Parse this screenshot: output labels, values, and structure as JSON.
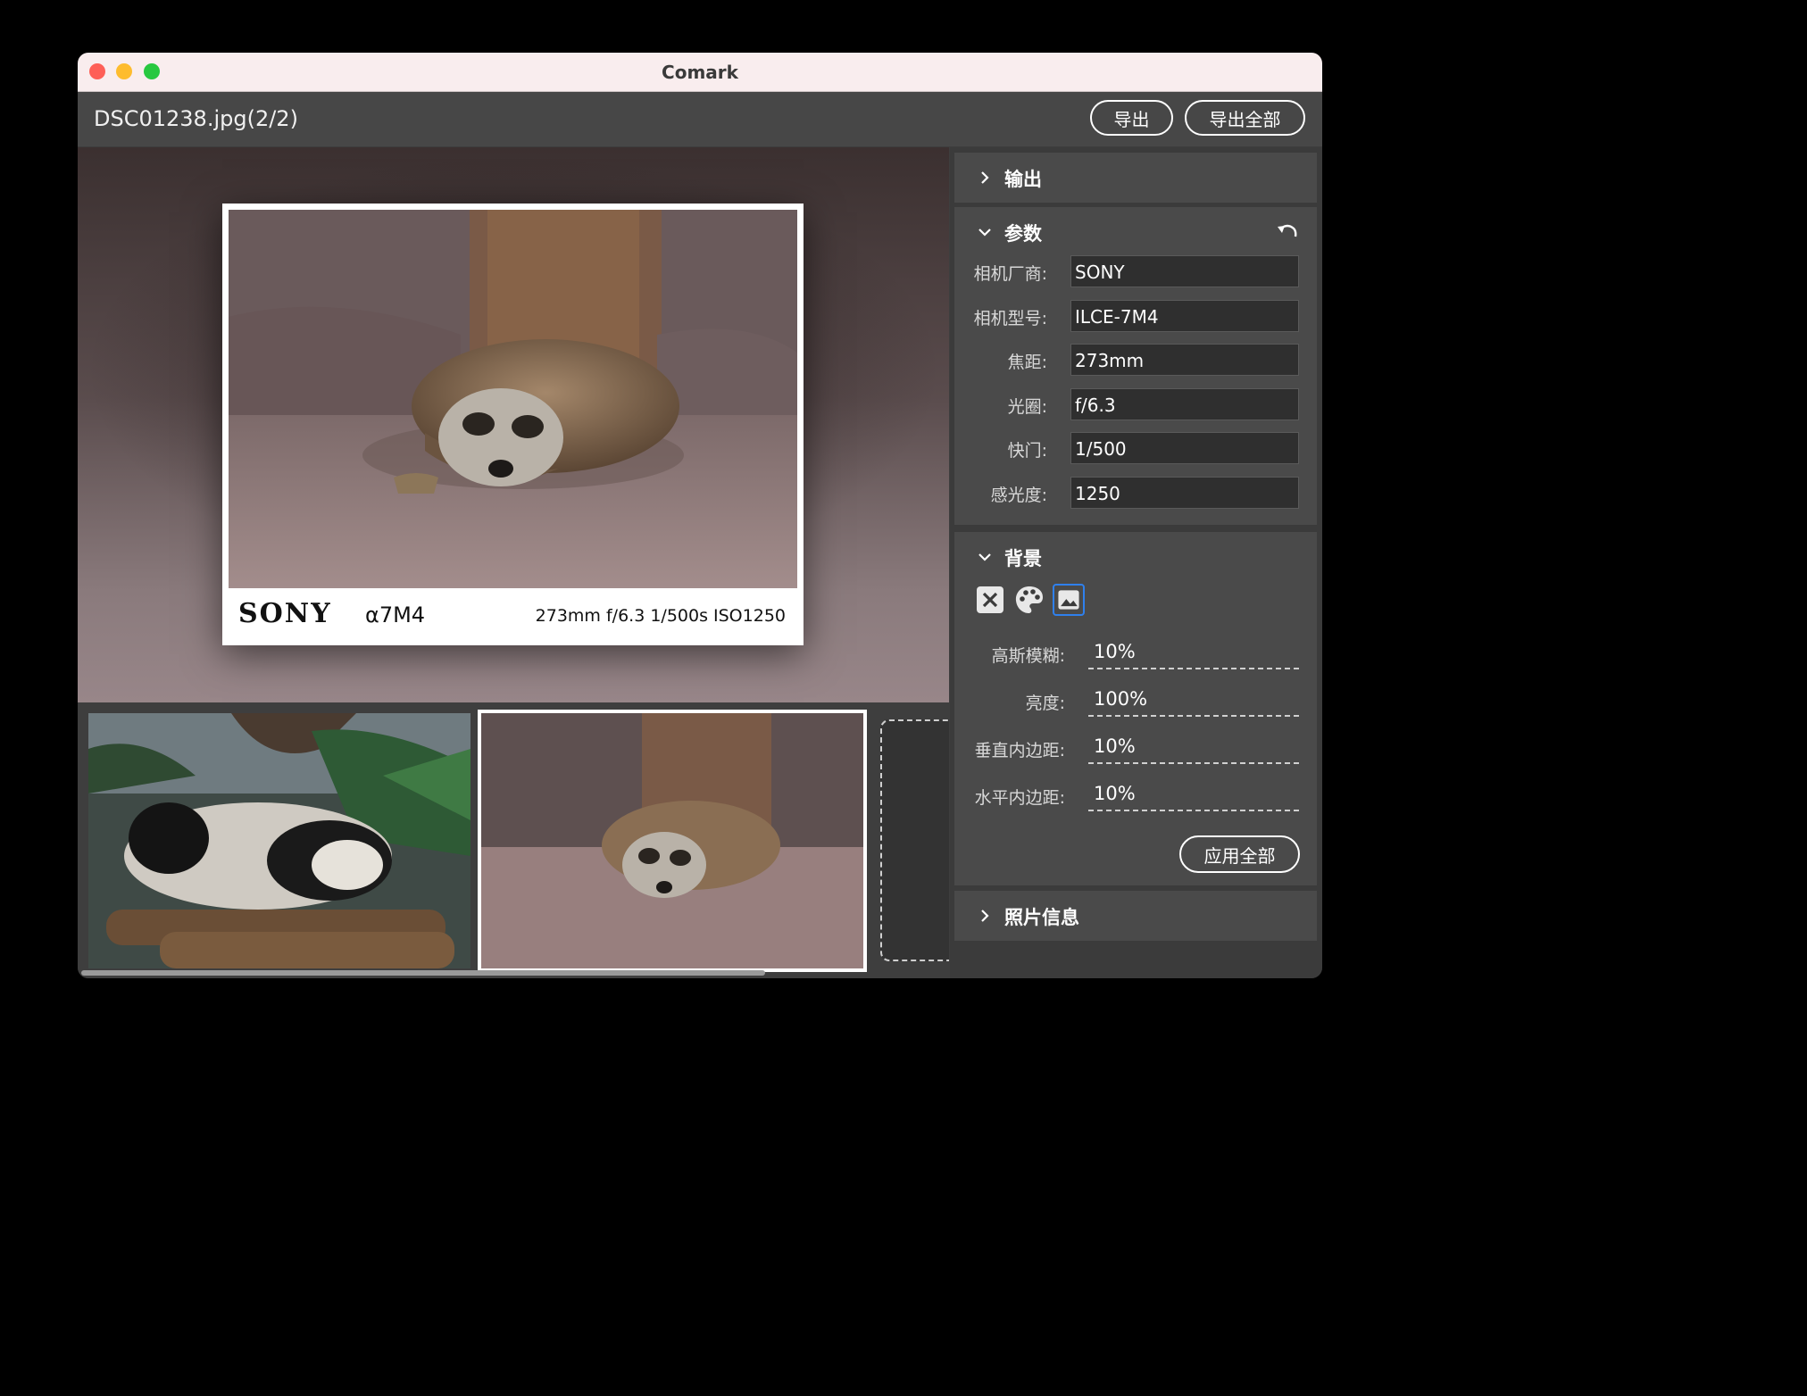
{
  "window": {
    "title": "Comark"
  },
  "toolbar": {
    "file_name": "DSC01238.jpg(2/2)",
    "export_label": "导出",
    "export_all_label": "导出全部"
  },
  "preview": {
    "watermark": {
      "brand": "SONY",
      "model": "α7M4",
      "params": "273mm  f/6.3  1/500s  ISO1250"
    }
  },
  "filmstrip": {
    "items": [
      "panda-photo",
      "meerkat-photo"
    ],
    "selected_index": 1
  },
  "sidebar": {
    "output": {
      "title": "输出",
      "expanded": false
    },
    "params": {
      "title": "参数",
      "expanded": true,
      "fields": [
        {
          "label": "相机厂商:",
          "value": "SONY"
        },
        {
          "label": "相机型号:",
          "value": "ILCE-7M4"
        },
        {
          "label": "焦距:",
          "value": "273mm"
        },
        {
          "label": "光圈:",
          "value": "f/6.3"
        },
        {
          "label": "快门:",
          "value": "1/500"
        },
        {
          "label": "感光度:",
          "value": "1250"
        }
      ]
    },
    "background": {
      "title": "背景",
      "expanded": true,
      "icons": [
        "close-box-icon",
        "palette-icon",
        "image-icon"
      ],
      "selected_icon": "image-icon",
      "sliders": [
        {
          "label": "高斯模糊:",
          "value": "10%"
        },
        {
          "label": "亮度:",
          "value": "100%"
        },
        {
          "label": "垂直内边距:",
          "value": "10%"
        },
        {
          "label": "水平内边距:",
          "value": "10%"
        }
      ],
      "apply_all_label": "应用全部"
    },
    "photo_info": {
      "title": "照片信息",
      "expanded": false
    }
  },
  "colors": {
    "accent": "#2f80ed",
    "panel": "#4a4a4a",
    "toolbar": "#474747",
    "titlebar": "#f9edee"
  }
}
